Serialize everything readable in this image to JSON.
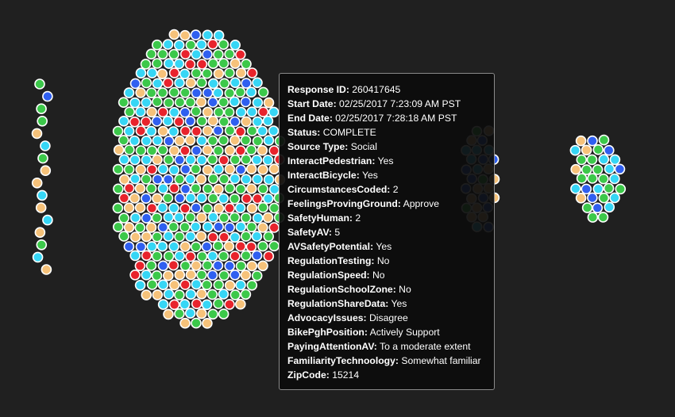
{
  "colors": {
    "background": "#202020",
    "green": "#3cc84a",
    "cyan": "#36d6f5",
    "orange": "#f6c27a",
    "red": "#e8232c",
    "blue": "#2f5ff0",
    "purple": "#7b2fe0",
    "dot_stroke": "#ffffff"
  },
  "tooltip": {
    "rows": [
      {
        "key": "Response ID:",
        "value": "260417645"
      },
      {
        "key": "Start Date:",
        "value": "02/25/2017 7:23:09 AM PST"
      },
      {
        "key": "End Date:",
        "value": "02/25/2017 7:28:18 AM PST"
      },
      {
        "key": "Status:",
        "value": "COMPLETE"
      },
      {
        "key": "Source Type:",
        "value": "Social"
      },
      {
        "key": "InteractPedestrian:",
        "value": "Yes"
      },
      {
        "key": "InteractBicycle:",
        "value": "Yes"
      },
      {
        "key": "CircumstancesCoded:",
        "value": "2"
      },
      {
        "key": "FeelingsProvingGround:",
        "value": "Approve"
      },
      {
        "key": "SafetyHuman:",
        "value": "2"
      },
      {
        "key": "SafetyAV:",
        "value": "5"
      },
      {
        "key": "AVSafetyPotential:",
        "value": "Yes"
      },
      {
        "key": "RegulationTesting:",
        "value": "No"
      },
      {
        "key": "RegulationSpeed:",
        "value": "No"
      },
      {
        "key": "RegulationSchoolZone:",
        "value": "No"
      },
      {
        "key": "RegulationShareData:",
        "value": "Yes"
      },
      {
        "key": "AdvocacyIssues:",
        "value": "Disagree"
      },
      {
        "key": "BikePghPosition:",
        "value": "Actively Support"
      },
      {
        "key": "PayingAttentionAV:",
        "value": "To a moderate extent"
      },
      {
        "key": "FamiliarityTechnoology:",
        "value": "Somewhat familiar"
      },
      {
        "key": "ZipCode:",
        "value": "15214"
      }
    ]
  }
}
